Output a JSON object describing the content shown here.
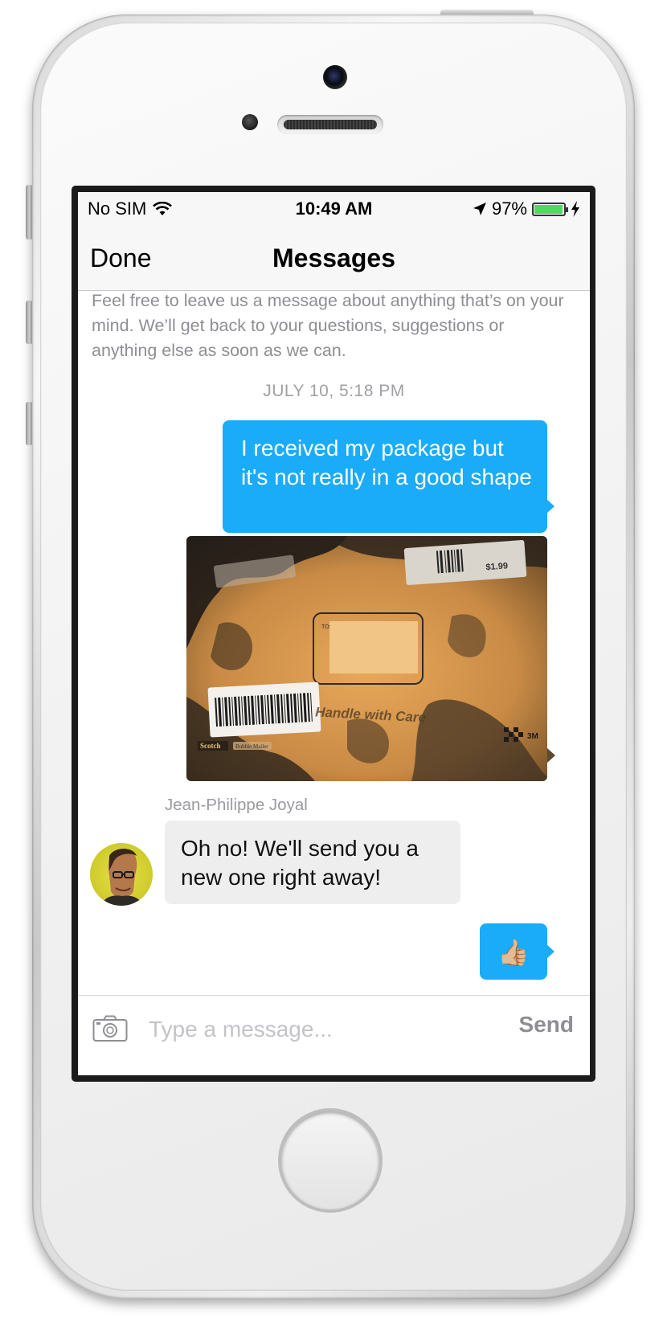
{
  "status_bar": {
    "carrier": "No SIM",
    "time": "10:49 AM",
    "battery": "97%",
    "battery_level": 0.97,
    "icons": [
      "wifi-icon",
      "location-arrow-icon",
      "battery-icon",
      "charging-bolt-icon"
    ]
  },
  "nav": {
    "done_label": "Done",
    "title": "Messages"
  },
  "conversation": {
    "intro": "Feel free to leave us a message about anything that’s on your mind. We’ll get back to your questions, suggestions or anything else as soon as we can.",
    "timestamp": "JULY 10, 5:18 PM",
    "messages": [
      {
        "direction": "outgoing",
        "type": "text",
        "text": "I received my package but it's not really in a good shape"
      },
      {
        "direction": "outgoing",
        "type": "image",
        "image_text": [
          "$1.99",
          "Handle with Care",
          "Scotch",
          "Bubble Mailer",
          "3M",
          "TO:"
        ]
      },
      {
        "direction": "incoming",
        "type": "text",
        "sender": "Jean-Philippe Joyal",
        "text": "Oh no! We'll send you a new one right away!"
      },
      {
        "direction": "outgoing",
        "type": "emoji",
        "text": "👍🏼"
      }
    ]
  },
  "composer": {
    "placeholder": "Type a message...",
    "send_label": "Send",
    "camera_icon": "camera-icon"
  },
  "colors": {
    "outgoing_bubble": "#1aabf9",
    "incoming_bubble": "#eeeeee",
    "battery_fill": "#4cd964"
  }
}
